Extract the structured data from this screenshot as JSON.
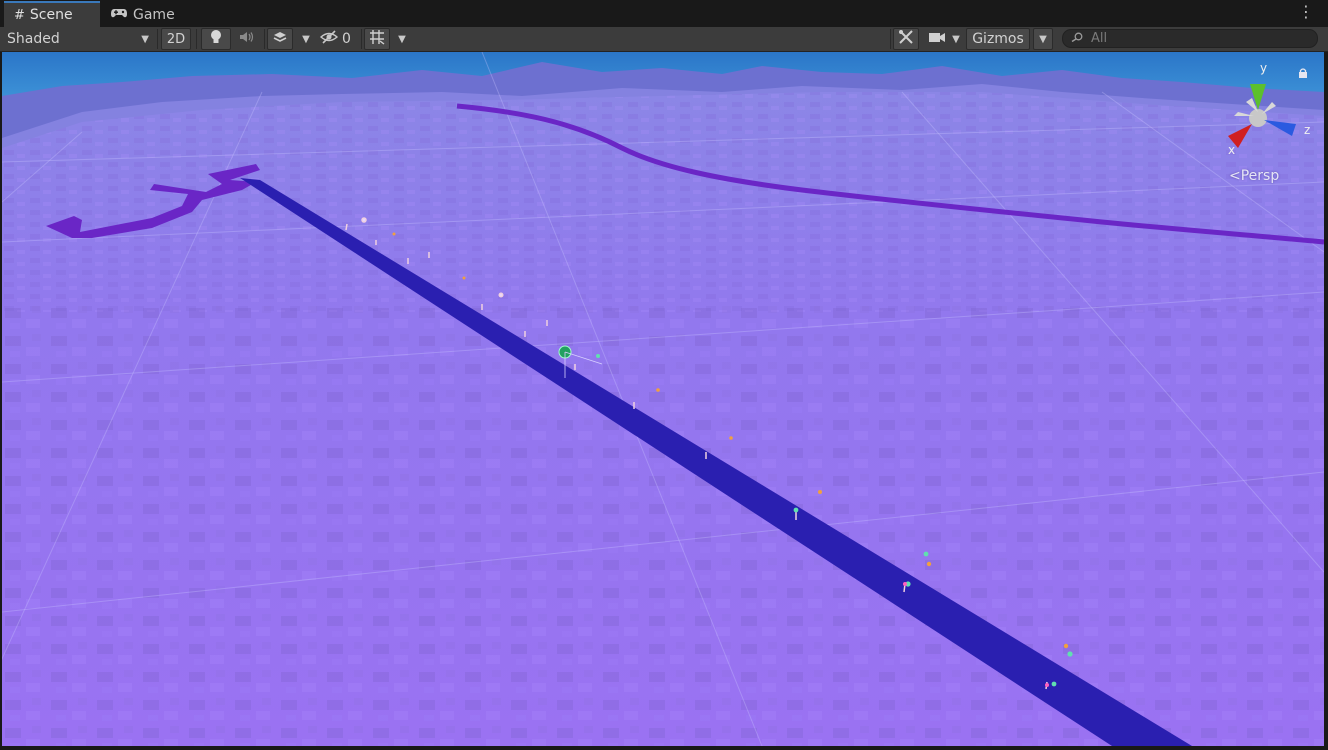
{
  "tabs": [
    {
      "label": "Scene",
      "icon": "grid-icon",
      "active": true
    },
    {
      "label": "Game",
      "icon": "gamepad-icon",
      "active": false
    }
  ],
  "toolbar": {
    "shading_mode": "Shaded",
    "mode_2d": "2D",
    "hidden_count": "0",
    "gizmos_label": "Gizmos",
    "search_placeholder": "All"
  },
  "viewport": {
    "projection_label": "Persp",
    "axis_labels": {
      "x": "x",
      "y": "y",
      "z": "z"
    }
  },
  "colors": {
    "accent": "#3a79bb",
    "terrain": "#9575f0",
    "road": "#2a1fb0",
    "path": "#6a28c8",
    "sky": "#3a8fd8"
  }
}
